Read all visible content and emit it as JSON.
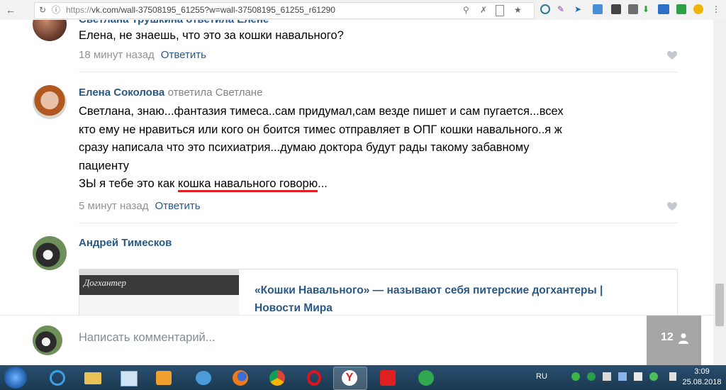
{
  "browser": {
    "url_scheme": "https://",
    "url_rest": "vk.com/wall-37508195_61255?w=wall-37508195_61255_r61290"
  },
  "comments": [
    {
      "author_partial": "Светлана Трушкина ответила Елене",
      "text": "Елена, не знаешь, что это за кошки навального?",
      "time": "18 минут назад",
      "answer": "Ответить"
    },
    {
      "author": "Елена Соколова",
      "reply_to": "ответила Светлане",
      "text_lines": [
        "Светлана, знаю...фантазия тимеса..сам придумал,сам везде пишет и сам пугается...всех",
        "кто ему не нравиться или кого он боится тимес отправляет в ОПГ кошки навального..я ж",
        "сразу написала что это психиатрия...думаю доктора будут рады такому забавному",
        "пациенту"
      ],
      "text_last_prefix": "ЗЫ я тебе это как ",
      "text_last_underlined": "кошка навального говорю",
      "text_last_suffix": "...",
      "time": "5 минут назад",
      "answer": "Ответить"
    },
    {
      "author": "Андрей Тимесков",
      "link_title_line1": "«Кошки Навального» — называют себя питерские догхантеры |",
      "link_title_line2": "Новости Мира",
      "link_site": "Догхантер"
    }
  ],
  "composer": {
    "placeholder": "Написать комментарий...",
    "viewers_count": "12"
  },
  "taskbar": {
    "lang": "RU",
    "time": "3:09",
    "date": "25.08.2018"
  },
  "colors": {
    "link": "#2a5885",
    "underline": "#e02020",
    "taskbar": "#1b3850"
  }
}
